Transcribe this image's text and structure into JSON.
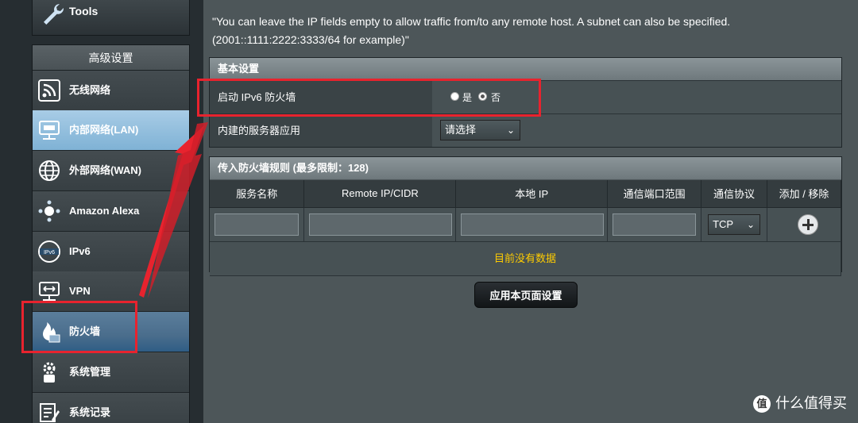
{
  "sidebar": {
    "tools_label": "Tools",
    "section_title": "高级设置",
    "items": [
      {
        "label": "无线网络",
        "icon": "wifi-icon"
      },
      {
        "label": "内部网络(LAN)",
        "icon": "lan-icon"
      },
      {
        "label": "外部网络(WAN)",
        "icon": "globe-icon"
      },
      {
        "label": "Amazon Alexa",
        "icon": "alexa-icon"
      },
      {
        "label": "IPv6",
        "icon": "ipv6-icon"
      },
      {
        "label": "VPN",
        "icon": "vpn-icon"
      },
      {
        "label": "防火墙",
        "icon": "firewall-icon"
      },
      {
        "label": "系统管理",
        "icon": "admin-gear-icon"
      },
      {
        "label": "系统记录",
        "icon": "log-icon"
      }
    ]
  },
  "main": {
    "note": "\"You can leave the IP fields empty to allow traffic from/to any remote host. A subnet can also be specified. (2001::1111:2222:3333/64 for example)\"",
    "basic": {
      "title": "基本设置",
      "enable_label": "启动 IPv6 防火墙",
      "yes": "是",
      "no": "否",
      "selected": "否",
      "service_label": "内建的服务器应用",
      "service_select": "请选择"
    },
    "rules": {
      "title": "传入防火墙规则 (最多限制：128)",
      "columns": [
        "服务名称",
        "Remote IP/CIDR",
        "本地 IP",
        "通信端口范围",
        "通信协议",
        "添加 / 移除"
      ],
      "protocol": "TCP",
      "no_data": "目前没有数据"
    },
    "apply_button": "应用本页面设置"
  },
  "watermark": {
    "logo": "值",
    "text": "什么值得买"
  },
  "accent": "#e8232e"
}
